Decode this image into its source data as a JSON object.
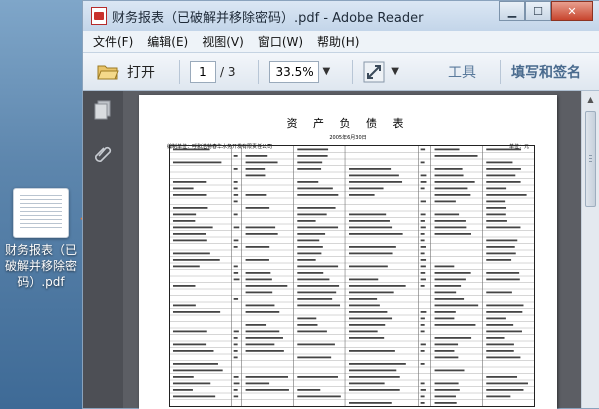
{
  "window": {
    "title": "财务报表（已破解并移除密码）.pdf - Adobe Reader",
    "minimize_label": "▁",
    "maximize_label": "☐",
    "close_label": "✕"
  },
  "menu": [
    "文件(F)",
    "编辑(E)",
    "视图(V)",
    "窗口(W)",
    "帮助(H)"
  ],
  "toolbar": {
    "open_label": "打开",
    "current_page": "1",
    "page_total": "/ 3",
    "zoom": "33.5%",
    "tools_label": "工具",
    "sign_label": "填写和签名"
  },
  "desktop": {
    "file_label": "财务报表（已破解并移除密码）.pdf"
  },
  "document": {
    "title": "资 产 负 债 表",
    "date": "2005年6月30日",
    "company": "编制单位：呼和浩特春华水务开发有限责任公司",
    "unit": "单位：元"
  },
  "icons": {
    "pdf": "pdf-file-icon",
    "open": "folder-open-icon",
    "pan": "pan-expand-icon",
    "pages": "page-thumbnails-icon",
    "attach": "paperclip-icon",
    "drag_arrow": "drag-arrow-icon"
  },
  "colors": {
    "accent_orange": "#e8772e",
    "tools_text": "#5a7a9c"
  }
}
